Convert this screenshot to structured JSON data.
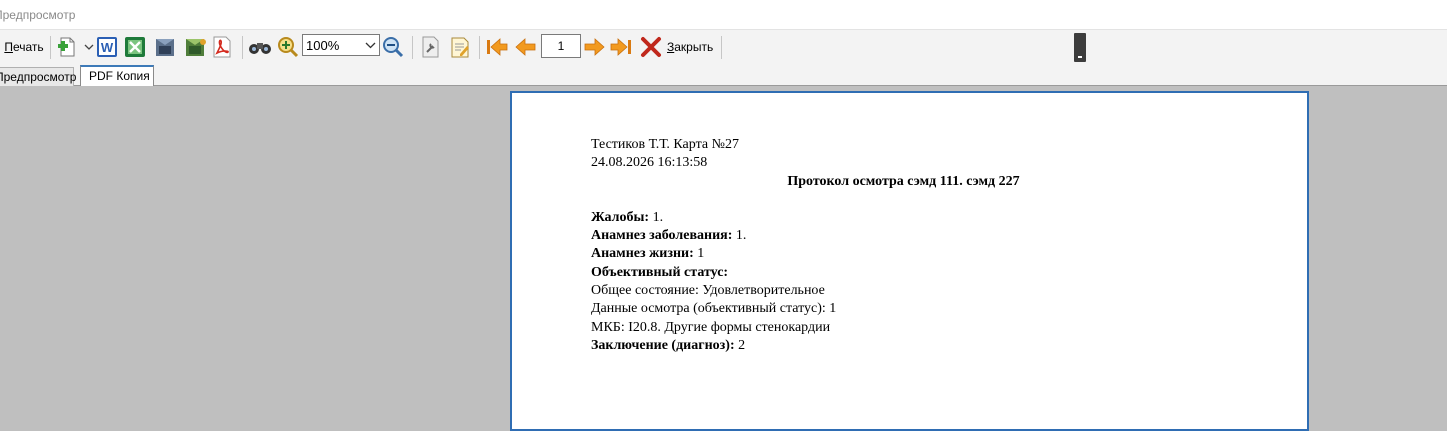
{
  "window": {
    "title": "Предпросмотр"
  },
  "toolbar": {
    "print_accel": "П",
    "print_rest": "ечать",
    "zoom_value": "100%",
    "page_number": "1",
    "close_accel": "З",
    "close_rest": "акрыть",
    "icons": [
      "new-doc-icon",
      "word-icon",
      "excel-icon",
      "export-icon",
      "export-color-icon",
      "pdf-icon",
      "binoculars-icon",
      "zoom-in-icon",
      "zoom-out-icon",
      "settings-icon",
      "edit-icon",
      "first-page-icon",
      "prev-page-icon",
      "next-page-icon",
      "last-page-icon",
      "close-icon"
    ]
  },
  "tabs": [
    {
      "label": "Предпросмотр"
    },
    {
      "label": "PDF Копия"
    }
  ],
  "document": {
    "header1": "Тестиков Т.Т. Карта №27",
    "header2": "24.08.2026 16:13:58",
    "title": "Протокол осмотра  сэмд 111. сэмд 227",
    "complaints_label": "Жалобы:",
    "complaints_value": " 1.",
    "anamnesis_label": "Анамнез заболевания:",
    "anamnesis_value": " 1.",
    "life_label": "Анамнез жизни:",
    "life_value": " 1",
    "status_label": "Объективный статус:",
    "general_state": "Общее состояние: Удовлетворительное",
    "exam_data": "Данные осмотра (объективный статус): 1",
    "mkb": "МКБ: I20.8. Другие формы стенокардии",
    "conclusion_label": "Заключение (диагноз):",
    "conclusion_value": " 2"
  },
  "colors": {
    "accent": "#2f6db3",
    "workspace": "#bfbfbf",
    "toolbar": "#f3f3f3"
  }
}
